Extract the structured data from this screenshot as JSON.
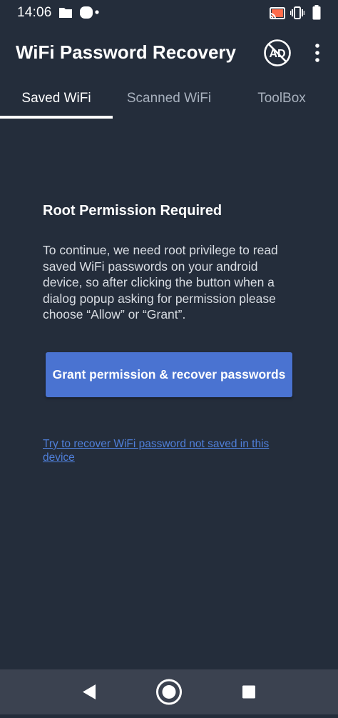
{
  "status_bar": {
    "time": "14:06",
    "left_icons": [
      "folder-icon",
      "circle-notification-icon",
      "dot-icon"
    ],
    "right_icons": [
      "cast-icon",
      "vibrate-icon",
      "battery-icon"
    ]
  },
  "app_bar": {
    "title": "WiFi Password Recovery",
    "ad_icon_text": "AD",
    "ad_icon": "no-ads-icon",
    "menu_icon": "more-vert-icon"
  },
  "tabs": [
    {
      "label": "Saved WiFi",
      "active": true
    },
    {
      "label": "Scanned WiFi",
      "active": false
    },
    {
      "label": "ToolBox",
      "active": false
    }
  ],
  "content": {
    "title": "Root Permission Required",
    "description": "To continue, we need root privilege to read saved WiFi passwords on your android device, so after clicking the button when a dialog popup asking for permission please choose “Allow” or “Grant”.",
    "grant_button_label": "Grant permission & recover passwords",
    "link_text": "Try to recover WiFi password not saved in this device"
  },
  "nav_bar": {
    "back_icon": "back-triangle-icon",
    "home_icon": "home-circle-icon",
    "recents_icon": "recents-square-icon"
  },
  "colors": {
    "background": "#242d3b",
    "accent_button": "#4a73d1",
    "link": "#4f7fd9",
    "nav_bar": "#3b4250",
    "inactive_tab": "#a7b0bd"
  }
}
